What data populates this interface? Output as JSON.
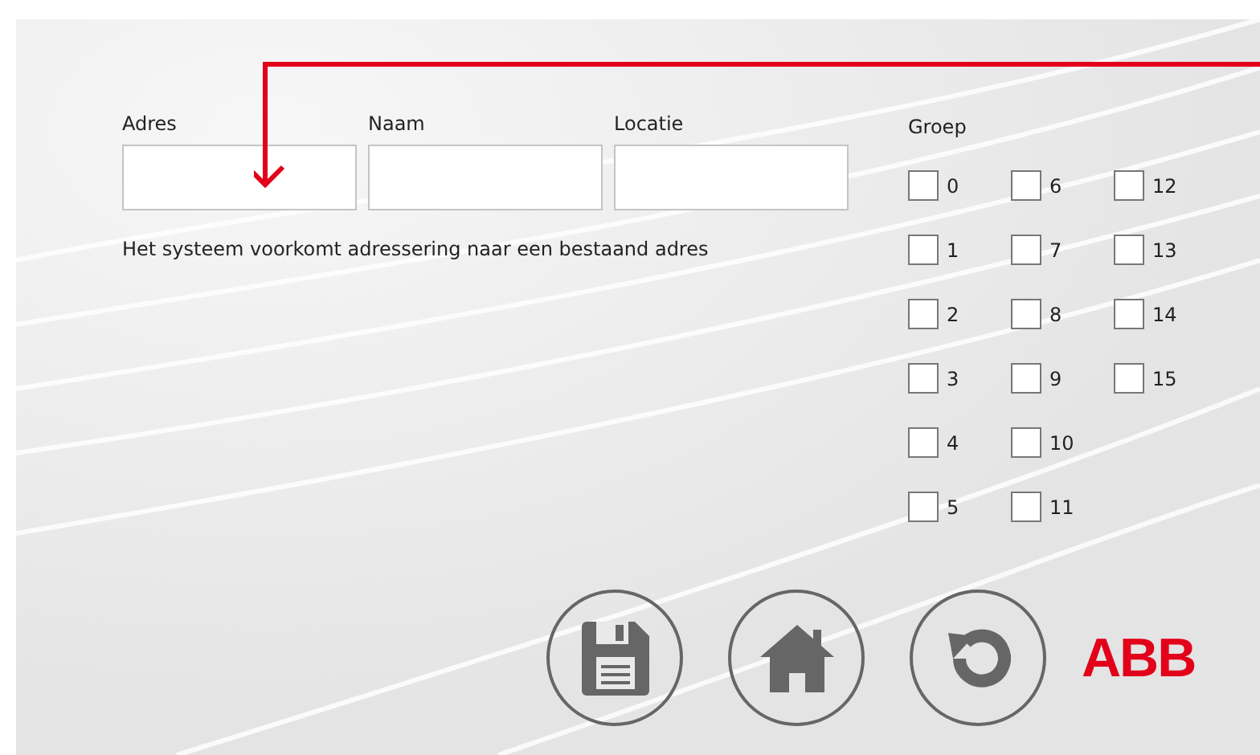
{
  "fields": [
    {
      "label": "Adres"
    },
    {
      "label": "Naam"
    },
    {
      "label": "Locatie"
    }
  ],
  "note": "Het systeem voorkomt adressering naar een bestaand adres",
  "group": {
    "label": "Groep",
    "options": [
      {
        "label": "0",
        "checked": false
      },
      {
        "label": "1",
        "checked": false
      },
      {
        "label": "2",
        "checked": false
      },
      {
        "label": "3",
        "checked": false
      },
      {
        "label": "4",
        "checked": false
      },
      {
        "label": "5",
        "checked": false
      },
      {
        "label": "6",
        "checked": false
      },
      {
        "label": "7",
        "checked": false
      },
      {
        "label": "8",
        "checked": false
      },
      {
        "label": "9",
        "checked": false
      },
      {
        "label": "10",
        "checked": false
      },
      {
        "label": "11",
        "checked": false
      },
      {
        "label": "12",
        "checked": false
      },
      {
        "label": "13",
        "checked": false
      },
      {
        "label": "14",
        "checked": false
      },
      {
        "label": "15",
        "checked": false
      }
    ]
  },
  "buttons": [
    {
      "kind": "save"
    },
    {
      "kind": "home"
    },
    {
      "kind": "reset"
    }
  ],
  "logo": "ABB"
}
